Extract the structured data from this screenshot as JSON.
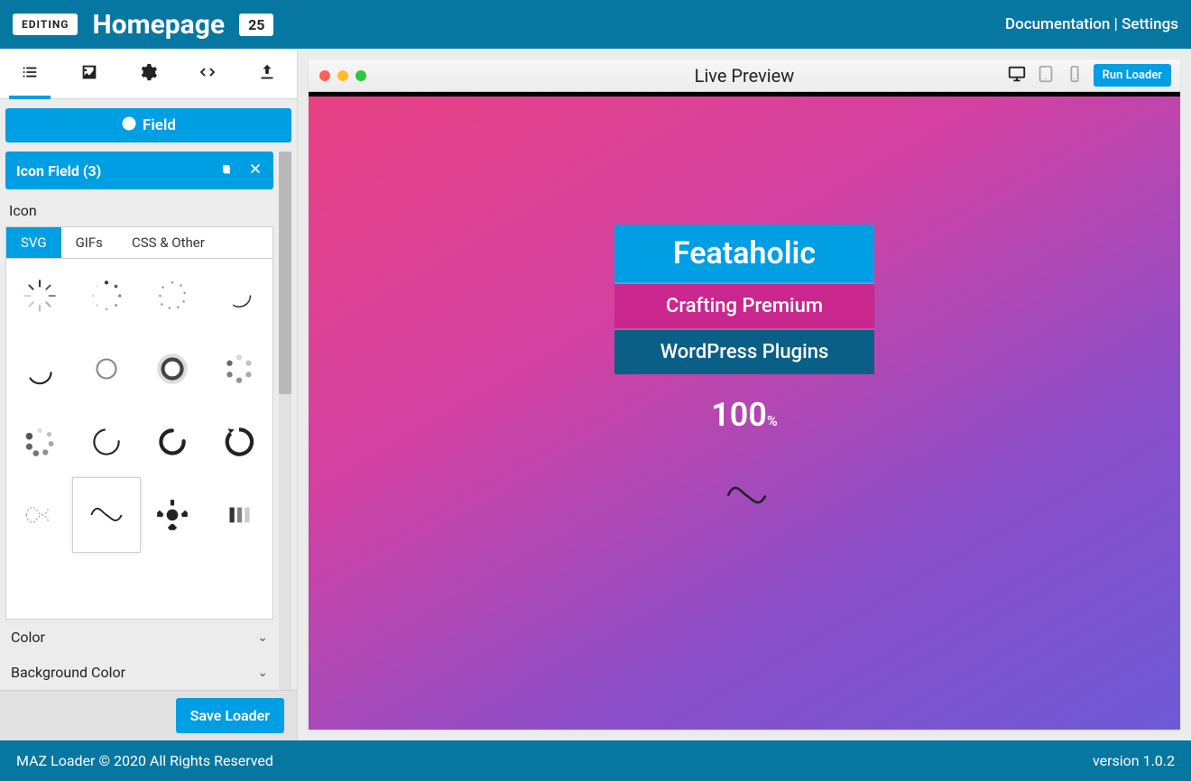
{
  "header": {
    "editing_badge": "EDITING",
    "title": "Homepage",
    "count": "25",
    "documentation_label": "Documentation",
    "divider": " | ",
    "settings_label": "Settings"
  },
  "sidebar": {
    "add_field_label": "Field",
    "card": {
      "title": "Icon Field (3)"
    },
    "icon_section_label": "Icon",
    "tabs": {
      "svg": "SVG",
      "gifs": "GIFs",
      "css": "CSS & Other"
    },
    "color_label": "Color",
    "bgcolor_label": "Background Color",
    "save_label": "Save Loader"
  },
  "preview": {
    "title": "Live Preview",
    "run_label": "Run Loader",
    "brand": "Feataholic",
    "line2": "Crafting Premium",
    "line3": "WordPress Plugins",
    "percent": "100",
    "percent_suffix": "%"
  },
  "footer": {
    "copyright": "MAZ Loader © 2020 All Rights Reserved",
    "version": "version 1.0.2"
  }
}
